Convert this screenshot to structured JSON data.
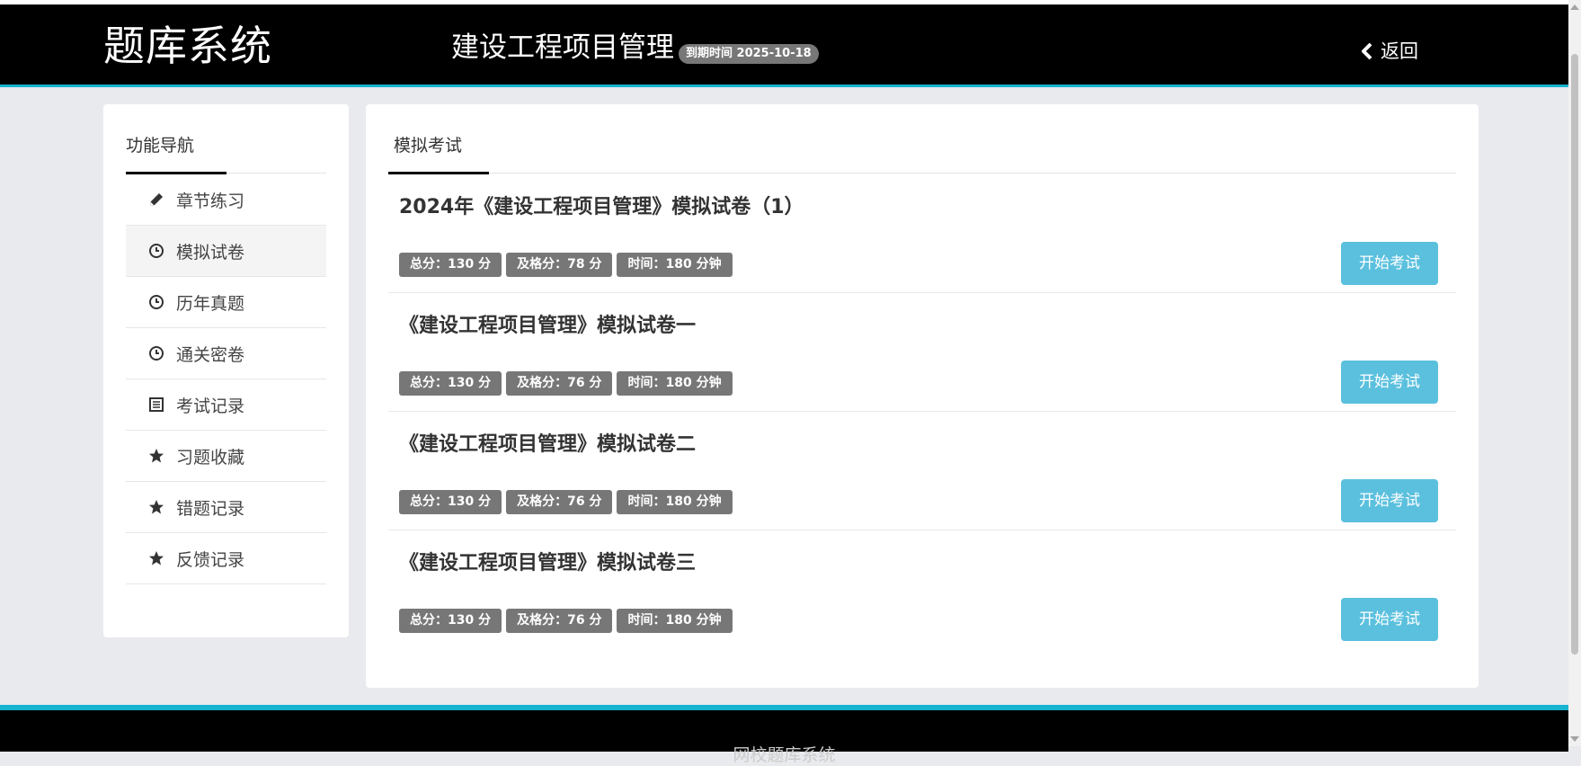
{
  "header": {
    "brand": "题库系统",
    "subject": "建设工程项目管理",
    "expire_badge": "到期时间 2025-10-18",
    "back_label": "返回"
  },
  "sidebar": {
    "title": "功能导航",
    "items": [
      {
        "label": "章节练习",
        "icon": "pencil-icon",
        "active": false
      },
      {
        "label": "模拟试卷",
        "icon": "clock-icon",
        "active": true
      },
      {
        "label": "历年真题",
        "icon": "clock-icon",
        "active": false
      },
      {
        "label": "通关密卷",
        "icon": "clock-icon",
        "active": false
      },
      {
        "label": "考试记录",
        "icon": "list-icon",
        "active": false
      },
      {
        "label": "习题收藏",
        "icon": "star-icon",
        "active": false
      },
      {
        "label": "错题记录",
        "icon": "star-icon",
        "active": false
      },
      {
        "label": "反馈记录",
        "icon": "star-icon",
        "active": false
      }
    ]
  },
  "main": {
    "tab": "模拟考试",
    "exams": [
      {
        "title": "2024年《建设工程项目管理》模拟试卷（1）",
        "total": "总分：130 分",
        "pass": "及格分：78 分",
        "time": "时间：180 分钟",
        "button": "开始考试"
      },
      {
        "title": "《建设工程项目管理》模拟试卷一",
        "total": "总分：130 分",
        "pass": "及格分：76 分",
        "time": "时间：180 分钟",
        "button": "开始考试"
      },
      {
        "title": "《建设工程项目管理》模拟试卷二",
        "total": "总分：130 分",
        "pass": "及格分：76 分",
        "time": "时间：180 分钟",
        "button": "开始考试"
      },
      {
        "title": "《建设工程项目管理》模拟试卷三",
        "total": "总分：130 分",
        "pass": "及格分：76 分",
        "time": "时间：180 分钟",
        "button": "开始考试"
      }
    ]
  },
  "footer": {
    "text": "网校题库系统"
  },
  "colors": {
    "header_bg": "#000000",
    "accent": "#17b3cf",
    "button": "#5bc0de",
    "badge": "#777777",
    "page_bg": "#e8eaee"
  }
}
